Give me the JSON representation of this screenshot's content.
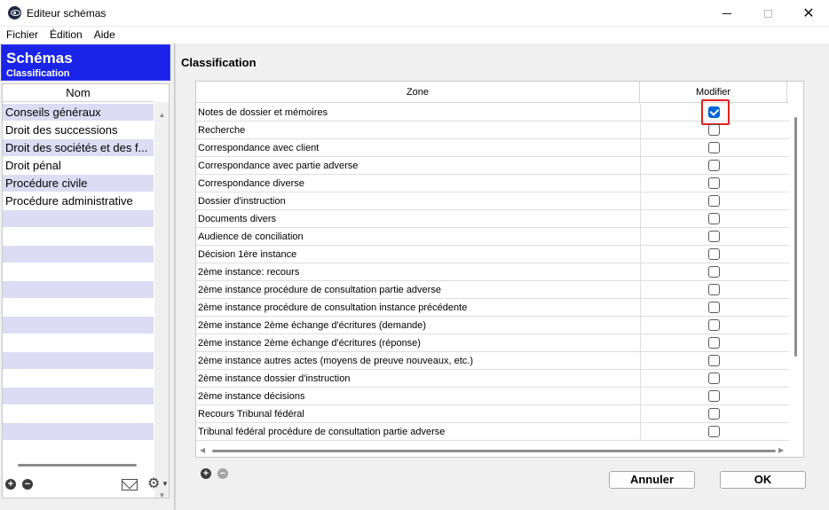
{
  "window": {
    "title": "Editeur schémas",
    "close_glyph": "✕"
  },
  "menu": [
    "Fichier",
    "Édition",
    "Aide"
  ],
  "left": {
    "header_title": "Schémas",
    "header_subtitle": "Classification",
    "column": "Nom",
    "items": [
      "Conseils généraux",
      "Droit des successions",
      "Droit des sociétés et des f...",
      "Droit pénal",
      "Procédure civile",
      "Procédure administrative"
    ],
    "add_glyph": "+",
    "remove_glyph": "−"
  },
  "right": {
    "title": "Classification",
    "columns": {
      "zone": "Zone",
      "modify": "Modifier"
    },
    "rows": [
      {
        "zone": "Notes de dossier et mémoires",
        "checked": true
      },
      {
        "zone": "Recherche",
        "checked": false
      },
      {
        "zone": "Correspondance avec client",
        "checked": false
      },
      {
        "zone": "Correspondance avec partie adverse",
        "checked": false
      },
      {
        "zone": "Correspondance diverse",
        "checked": false
      },
      {
        "zone": "Dossier d'instruction",
        "checked": false
      },
      {
        "zone": "Documents divers",
        "checked": false
      },
      {
        "zone": "Audience de conciliation",
        "checked": false
      },
      {
        "zone": "Décision 1ère instance",
        "checked": false
      },
      {
        "zone": "2ème instance: recours",
        "checked": false
      },
      {
        "zone": "2ème instance procédure de consultation partie adverse",
        "checked": false
      },
      {
        "zone": "2ème instance procédure de consultation instance précédente",
        "checked": false
      },
      {
        "zone": "2ème instance 2ème échange d'écritures (demande)",
        "checked": false
      },
      {
        "zone": "2ème instance 2ème échange d'écritures (réponse)",
        "checked": false
      },
      {
        "zone": "2ème instance autres actes (moyens de preuve nouveaux, etc.)",
        "checked": false
      },
      {
        "zone": "2ème instance dossier d'instruction",
        "checked": false
      },
      {
        "zone": "2ème instance décisions",
        "checked": false
      },
      {
        "zone": "Recours Tribunal fédéral",
        "checked": false
      },
      {
        "zone": "Tribunal fédéral procédure de consultation partie adverse",
        "checked": false
      }
    ],
    "add_glyph": "+",
    "remove_glyph": "−"
  },
  "buttons": {
    "cancel": "Annuler",
    "ok": "OK"
  },
  "colors": {
    "header_bg": "#1a23e8",
    "row_alt": "#dcdcf5",
    "checkbox_checked": "#0066d6",
    "focus_outline": "#e02020"
  }
}
